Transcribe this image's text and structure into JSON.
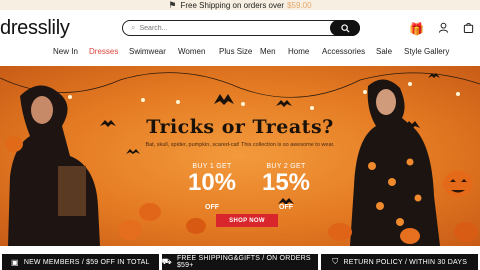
{
  "topbar": {
    "text": "Free Shipping on orders over",
    "amount": "$59.00"
  },
  "header": {
    "logo": "dresslily",
    "search_placeholder": "Search..."
  },
  "nav": [
    "New In",
    "Dresses",
    "Swimwear",
    "Women",
    "Plus Size",
    "Men",
    "Home",
    "Accessories",
    "Sale",
    "Style Gallery"
  ],
  "banner": {
    "headline": "Tricks or Treats?",
    "subtitle": "Bat, skull, spider, pumpkin, scared-cat! This collection is so awesome to wear.",
    "offer1": {
      "label": "BUY 1 GET",
      "value": "10%",
      "off": "OFF"
    },
    "offer2": {
      "label": "BUY 2 GET",
      "value": "15%",
      "off": "OFF"
    },
    "cta": "SHOP NOW"
  },
  "perks": [
    "NEW MEMBERS / $59 OFF IN TOTAL",
    "FREE SHIPPING&GIFTS / ON ORDERS $59+",
    "RETURN POLICY / WITHIN 30 DAYS"
  ],
  "colors": {
    "accent": "#e0443c",
    "banner": "#e47a22",
    "cta": "#d8262c"
  },
  "icons": [
    "truck-icon",
    "search-icon",
    "gift-icon",
    "user-icon",
    "bag-icon",
    "bat-icon",
    "pumpkin-icon",
    "member-icon",
    "shipping-icon",
    "return-icon"
  ]
}
